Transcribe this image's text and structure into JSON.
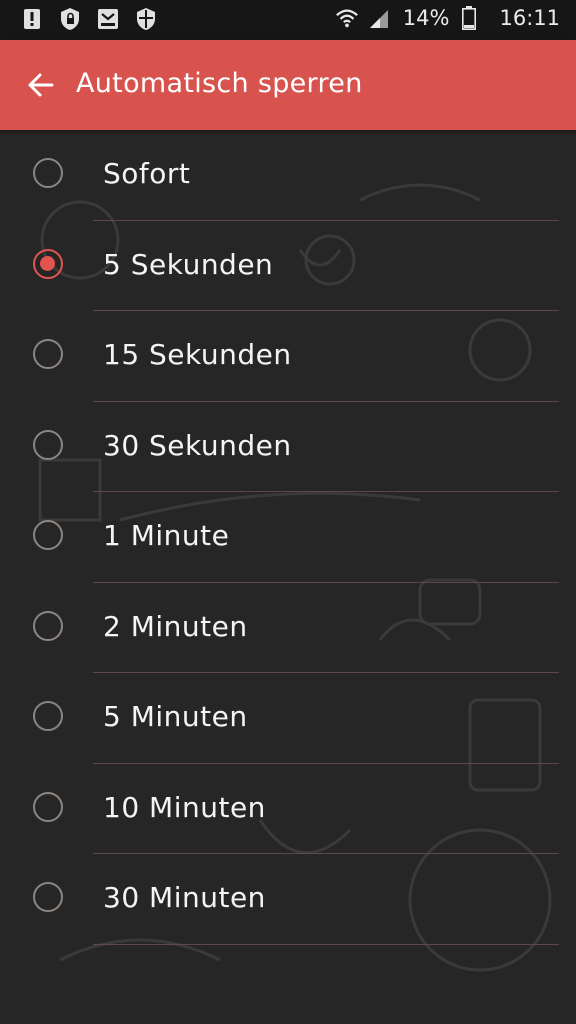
{
  "status_bar": {
    "icons_left": [
      "warning-icon",
      "shield-lock-icon",
      "samsung-gear-icon",
      "security-shield-icon"
    ],
    "icons_right": [
      "wifi-icon",
      "signal-icon",
      "battery-icon"
    ],
    "battery_percent": "14%",
    "time": "16:11"
  },
  "app_bar": {
    "title": "Automatisch sperren",
    "background_color": "#d9534e",
    "back_icon": "arrow-left-icon"
  },
  "accent_color": "#e2544f",
  "options": [
    {
      "label": "Sofort",
      "selected": false
    },
    {
      "label": "5 Sekunden",
      "selected": true
    },
    {
      "label": "15 Sekunden",
      "selected": false
    },
    {
      "label": "30 Sekunden",
      "selected": false
    },
    {
      "label": "1 Minute",
      "selected": false
    },
    {
      "label": "2 Minuten",
      "selected": false
    },
    {
      "label": "5 Minuten",
      "selected": false
    },
    {
      "label": "10 Minuten",
      "selected": false
    },
    {
      "label": "30 Minuten",
      "selected": false
    }
  ]
}
